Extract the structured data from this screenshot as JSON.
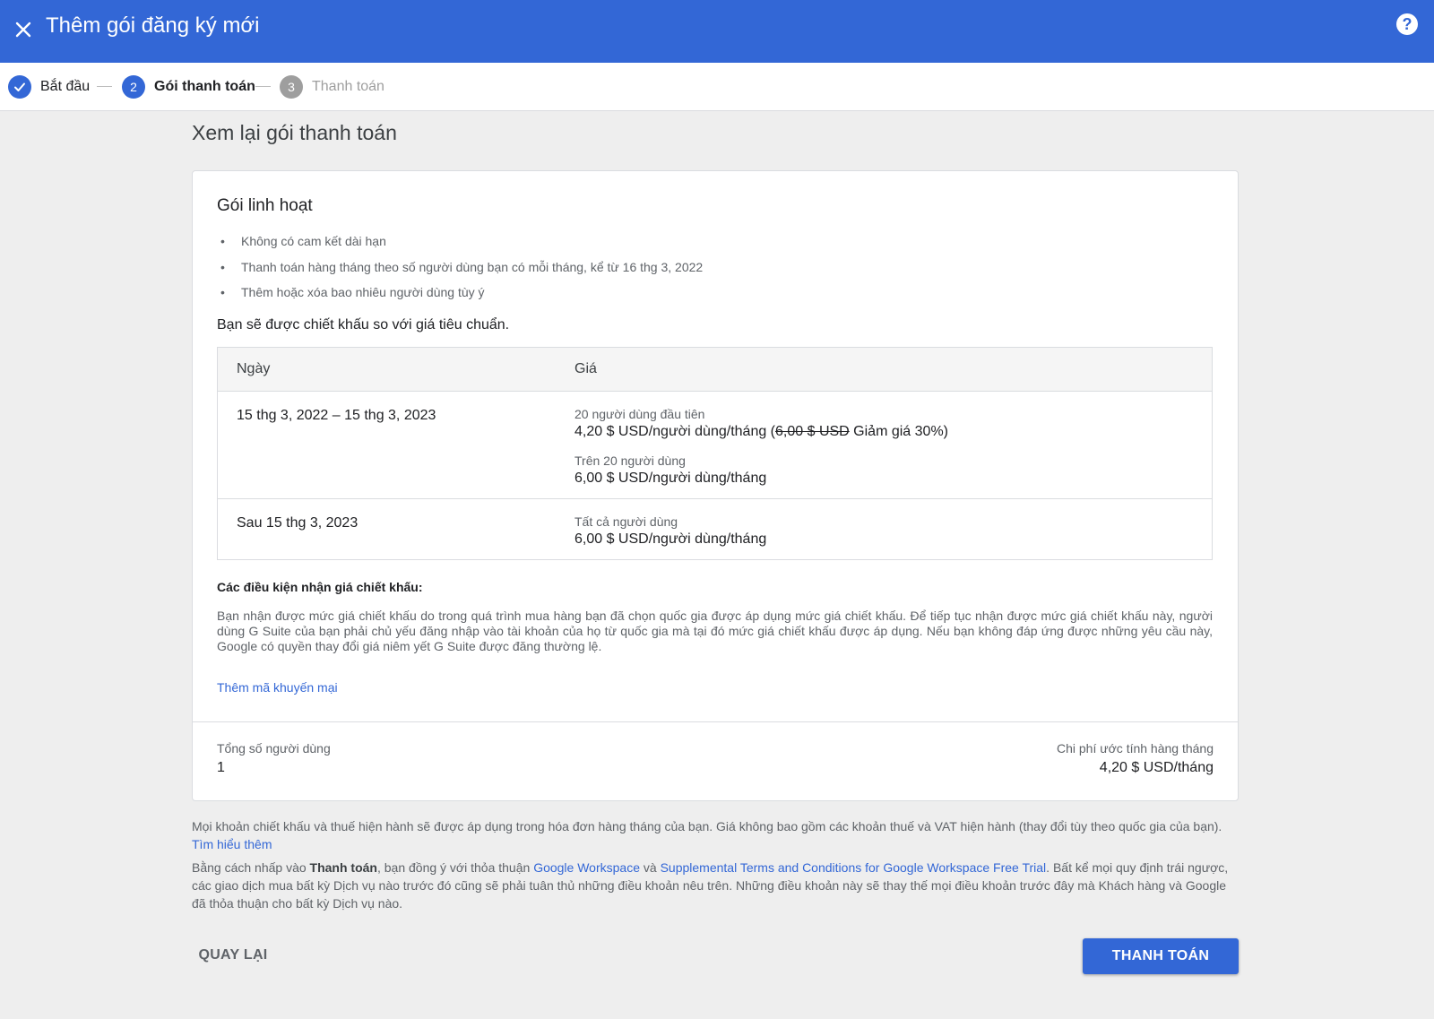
{
  "header": {
    "title": "Thêm gói đăng ký mới",
    "close_icon": "close-icon",
    "help_icon": "help-icon",
    "help_glyph": "?"
  },
  "stepper": {
    "steps": [
      {
        "number": "",
        "label": "Bắt đầu",
        "state": "done"
      },
      {
        "number": "2",
        "label": "Gói thanh toán",
        "state": "active"
      },
      {
        "number": "3",
        "label": "Thanh toán",
        "state": "pending"
      }
    ]
  },
  "page_title": "Xem lại gói thanh toán",
  "plan": {
    "title": "Gói linh hoạt",
    "features": [
      "Không có cam kết dài hạn",
      "Thanh toán hàng tháng theo số người dùng bạn có mỗi tháng, kể từ 16 thg 3, 2022",
      "Thêm hoặc xóa bao nhiêu người dùng tùy ý"
    ],
    "discount_intro": "Bạn sẽ được chiết khấu so với giá tiêu chuẩn."
  },
  "price_table": {
    "headers": {
      "date": "Ngày",
      "price": "Giá"
    },
    "rows": [
      {
        "date": "15 thg 3, 2022 – 15 thg 3, 2023",
        "tiers": [
          {
            "label": "20 người dùng đầu tiên",
            "price_prefix": "4,20 $ USD/người dùng/tháng (",
            "strike": "6,00 $ USD",
            "price_suffix": " Giảm giá 30%)"
          },
          {
            "label": "Trên 20 người dùng",
            "price": "6,00 $ USD/người dùng/tháng"
          }
        ]
      },
      {
        "date": "Sau 15 thg 3, 2023",
        "tiers": [
          {
            "label": "Tất cả người dùng",
            "price": "6,00 $ USD/người dùng/tháng"
          }
        ]
      }
    ]
  },
  "conditions": {
    "title": "Các điều kiện nhận giá chiết khấu:",
    "text": "Bạn nhận được mức giá chiết khấu do trong quá trình mua hàng bạn đã chọn quốc gia được áp dụng mức giá chiết khấu. Để tiếp tục nhận được mức giá chiết khấu này, người dùng G Suite của bạn phải chủ yếu đăng nhập vào tài khoản của họ từ quốc gia mà tại đó mức giá chiết khấu được áp dụng. Nếu bạn không đáp ứng được những yêu cầu này, Google có quyền thay đổi giá niêm yết G Suite được đăng thường lệ."
  },
  "promo_link": "Thêm mã khuyến mại",
  "summary": {
    "total_users_label": "Tổng số người dùng",
    "total_users_value": "1",
    "estimate_label": "Chi phí ước tính hàng tháng",
    "estimate_value": "4,20 $ USD/tháng"
  },
  "footnotes": {
    "tax_text": "Mọi khoản chiết khấu và thuế hiện hành sẽ được áp dụng trong hóa đơn hàng tháng của bạn. Giá không bao gồm các khoản thuế và VAT hiện hành (thay đổi tùy theo quốc gia của bạn). ",
    "learn_more": "Tìm hiểu thêm",
    "agree_prefix": "Bằng cách nhấp vào ",
    "agree_bold": "Thanh toán",
    "agree_mid": ", bạn đồng ý với thỏa thuận ",
    "link_workspace": "Google Workspace",
    "agree_and": " và ",
    "link_terms": "Supplemental Terms and Conditions for Google Workspace Free Trial",
    "agree_suffix": ". Bất kể mọi quy định trái ngược, các giao dịch mua bất kỳ Dịch vụ nào trước đó cũng sẽ phải tuân thủ những điều khoản nêu trên. Những điều khoản này sẽ thay thế mọi điều khoản trước đây mà Khách hàng và Google đã thỏa thuận cho bất kỳ Dịch vụ nào."
  },
  "actions": {
    "back": "QUAY LẠI",
    "pay": "THANH TOÁN"
  },
  "colors": {
    "brand_blue": "#3367d6",
    "background": "#eeeeee",
    "pending_gray": "#9e9e9e"
  }
}
